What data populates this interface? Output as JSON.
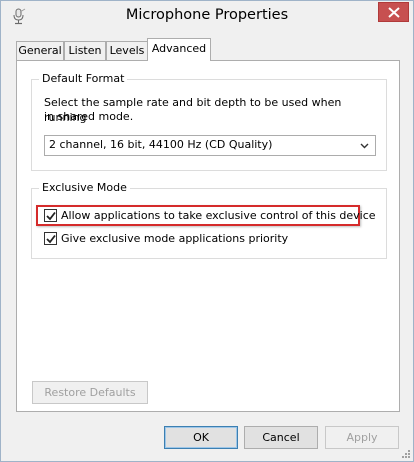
{
  "window": {
    "title": "Microphone Properties",
    "icon": "microphone-icon",
    "close_icon": "close-icon"
  },
  "tabs": [
    {
      "label": "General",
      "active": false
    },
    {
      "label": "Listen",
      "active": false
    },
    {
      "label": "Levels",
      "active": false
    },
    {
      "label": "Advanced",
      "active": true
    }
  ],
  "default_format": {
    "legend": "Default Format",
    "description_line1": "Select the sample rate and bit depth to be used when running",
    "description_line2": "in shared mode.",
    "selected": "2 channel, 16 bit, 44100 Hz (CD Quality)"
  },
  "exclusive_mode": {
    "legend": "Exclusive Mode",
    "options": [
      {
        "label": "Allow applications to take exclusive control of this device",
        "checked": true,
        "highlighted": true
      },
      {
        "label": "Give exclusive mode applications priority",
        "checked": true,
        "highlighted": false
      }
    ]
  },
  "restore_defaults_label": "Restore Defaults",
  "footer": {
    "ok_label": "OK",
    "cancel_label": "Cancel",
    "apply_label": "Apply"
  },
  "colors": {
    "highlight_border": "#d52b2b",
    "close_button": "#c75050",
    "default_button_border": "#3c7fb1"
  }
}
